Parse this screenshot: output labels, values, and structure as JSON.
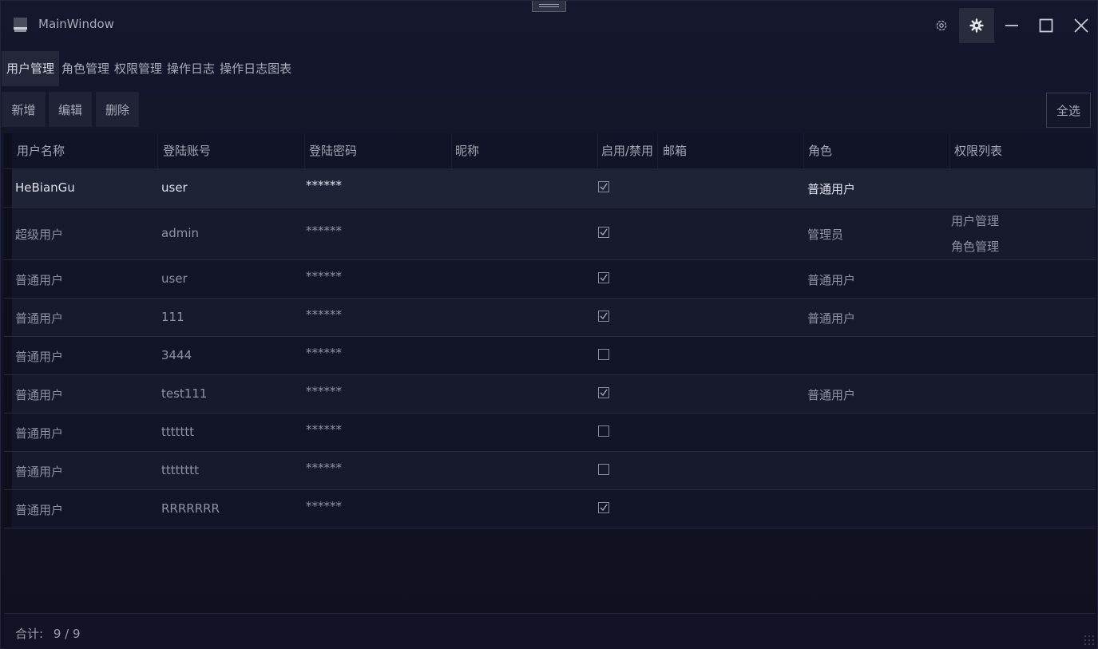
{
  "window": {
    "title": "MainWindow"
  },
  "tabs": [
    {
      "label": "用户管理",
      "active": true
    },
    {
      "label": "角色管理",
      "active": false
    },
    {
      "label": "权限管理",
      "active": false
    },
    {
      "label": "操作日志",
      "active": false
    },
    {
      "label": "操作日志图表",
      "active": false
    }
  ],
  "toolbar": {
    "add_label": "新增",
    "edit_label": "编辑",
    "delete_label": "删除",
    "select_all_label": "全选"
  },
  "table": {
    "columns": [
      "用户名称",
      "登陆账号",
      "登陆密码",
      "昵称",
      "启用/禁用",
      "邮箱",
      "角色",
      "权限列表"
    ],
    "rows": [
      {
        "name": "HeBianGu",
        "account": "user",
        "password": "******",
        "nickname": "",
        "enabled": true,
        "email": "",
        "role": "普通用户",
        "permissions": [],
        "selected": true
      },
      {
        "name": "超级用户",
        "account": "admin",
        "password": "******",
        "nickname": "",
        "enabled": true,
        "email": "",
        "role": "管理员",
        "permissions": [
          "用户管理",
          "角色管理"
        ]
      },
      {
        "name": "普通用户",
        "account": "user",
        "password": "******",
        "nickname": "",
        "enabled": true,
        "email": "",
        "role": "普通用户",
        "permissions": []
      },
      {
        "name": "普通用户",
        "account": "111",
        "password": "******",
        "nickname": "",
        "enabled": true,
        "email": "",
        "role": "普通用户",
        "permissions": []
      },
      {
        "name": "普通用户",
        "account": "3444",
        "password": "******",
        "nickname": "",
        "enabled": false,
        "email": "",
        "role": "",
        "permissions": []
      },
      {
        "name": "普通用户",
        "account": "test111",
        "password": "******",
        "nickname": "",
        "enabled": true,
        "email": "",
        "role": "普通用户",
        "permissions": []
      },
      {
        "name": "普通用户",
        "account": "ttttttt",
        "password": "******",
        "nickname": "",
        "enabled": false,
        "email": "",
        "role": "",
        "permissions": []
      },
      {
        "name": "普通用户",
        "account": "tttttttt",
        "password": "******",
        "nickname": "",
        "enabled": false,
        "email": "",
        "role": "",
        "permissions": []
      },
      {
        "name": "普通用户",
        "account": "RRRRRRR",
        "password": "******",
        "nickname": "",
        "enabled": true,
        "email": "",
        "role": "",
        "permissions": []
      }
    ]
  },
  "footer": {
    "total_label": "合计:",
    "total_value": "9 / 9"
  },
  "icons": {
    "app": "app-icon",
    "theme": "theme-settings-icon",
    "settings": "gear-icon",
    "minimize": "minimize-icon",
    "maximize": "maximize-icon",
    "close": "close-icon"
  },
  "colors": {
    "background": "#14162a",
    "selected_row": "#1f2336",
    "active_tab": "#24273a"
  }
}
